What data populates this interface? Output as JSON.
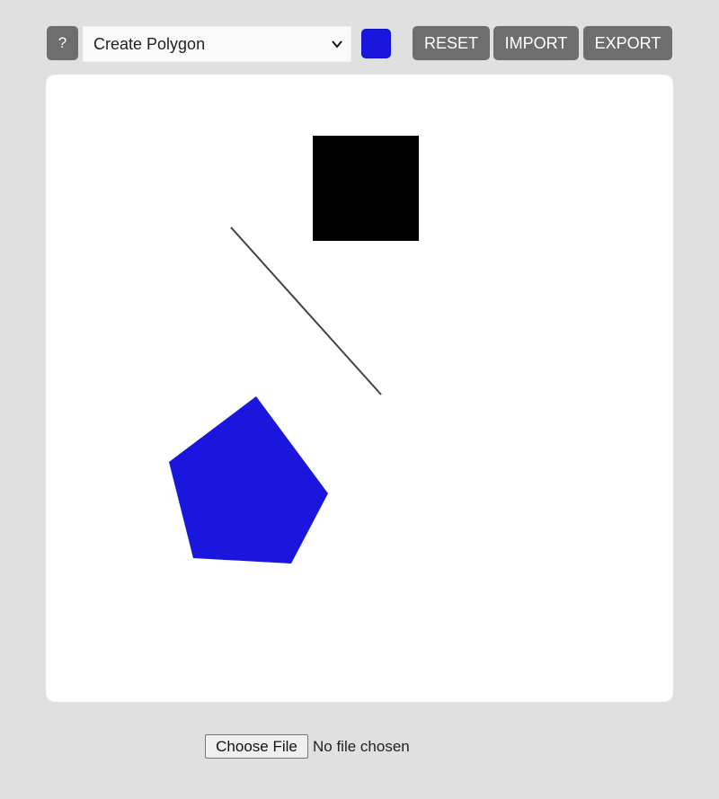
{
  "toolbar": {
    "help_label": "?",
    "mode_selected": "Create Polygon",
    "current_color": "#1a16dd",
    "reset_label": "RESET",
    "import_label": "IMPORT",
    "export_label": "EXPORT"
  },
  "canvas": {
    "shapes": [
      {
        "kind": "square",
        "name": "black-square",
        "fill": "#000000"
      },
      {
        "kind": "line",
        "name": "diagonal-line",
        "stroke": "#444444"
      },
      {
        "kind": "polygon",
        "name": "blue-pentagon",
        "fill": "#1a16dd",
        "sides": 5
      }
    ]
  },
  "file_input": {
    "button_label": "Choose File",
    "status_text": "No file chosen"
  }
}
